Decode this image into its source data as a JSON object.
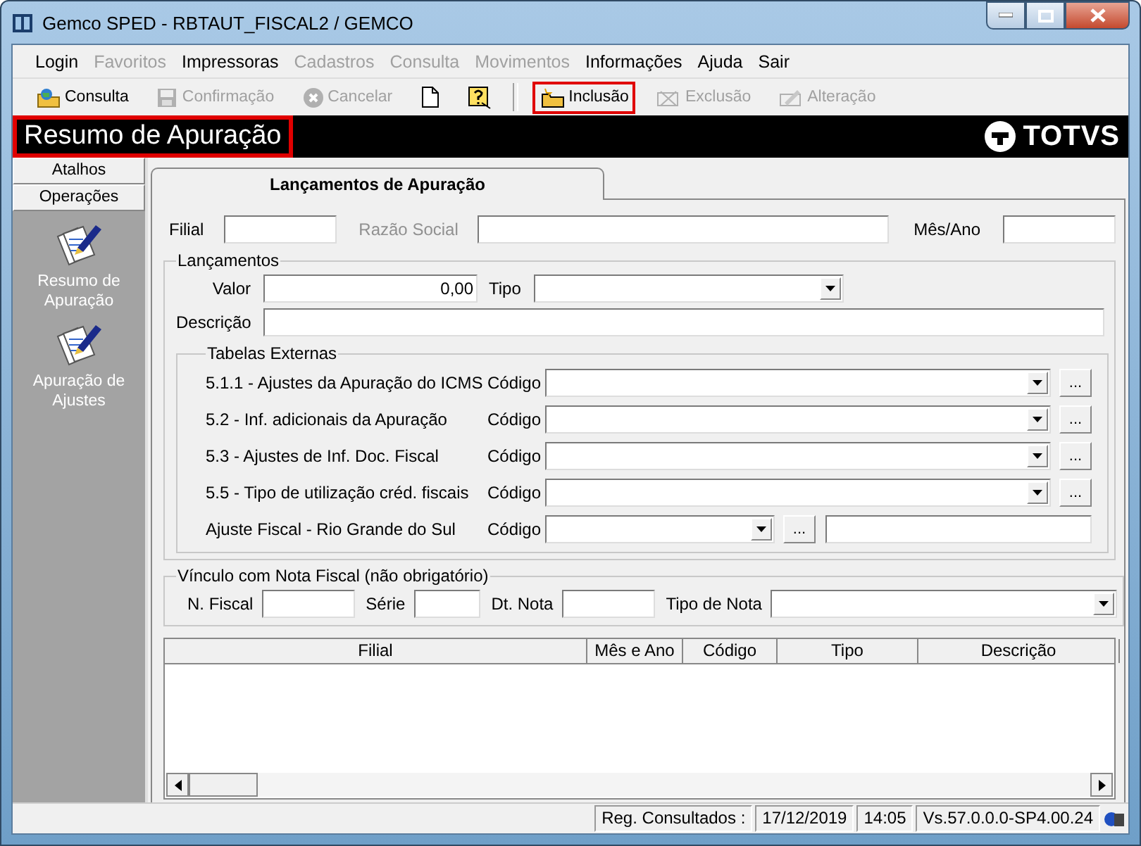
{
  "window": {
    "title": "Gemco SPED - RBTAUT_FISCAL2 / GEMCO"
  },
  "menu": [
    {
      "label": "Login",
      "disabled": false
    },
    {
      "label": "Favoritos",
      "disabled": true
    },
    {
      "label": "Impressoras",
      "disabled": false
    },
    {
      "label": "Cadastros",
      "disabled": true
    },
    {
      "label": "Consulta",
      "disabled": true
    },
    {
      "label": "Movimentos",
      "disabled": true
    },
    {
      "label": "Informações",
      "disabled": false
    },
    {
      "label": "Ajuda",
      "disabled": false
    },
    {
      "label": "Sair",
      "disabled": false
    }
  ],
  "toolbar": [
    {
      "kind": "search",
      "label": "Consulta",
      "disabled": false,
      "highlighted": false
    },
    {
      "kind": "save",
      "label": "Confirmação",
      "disabled": true,
      "highlighted": false
    },
    {
      "kind": "cancel",
      "label": "Cancelar",
      "disabled": true,
      "highlighted": false
    },
    {
      "kind": "new",
      "highlighted": false
    },
    {
      "kind": "help",
      "highlighted": false
    },
    {
      "kind": "separator"
    },
    {
      "kind": "add",
      "label": "Inclusão",
      "disabled": false,
      "highlighted": true
    },
    {
      "kind": "delete",
      "label": "Exclusão",
      "disabled": true,
      "highlighted": false
    },
    {
      "kind": "edit",
      "label": "Alteração",
      "disabled": true,
      "highlighted": false
    }
  ],
  "header": {
    "title": "Resumo de Apuração",
    "highlighted": true,
    "logo": "TOTVS"
  },
  "sidebar": {
    "sections": [
      "Atalhos",
      "Operações"
    ],
    "items": [
      {
        "label": "Resumo de Apuração"
      },
      {
        "label": "Apuração de Ajustes"
      }
    ]
  },
  "tabs": [
    {
      "label": "Lançamentos de Apuração",
      "selected": true
    }
  ],
  "header_fields": [
    {
      "label": "Filial",
      "kind": "short",
      "disabled": false
    },
    {
      "label": "Razão Social",
      "kind": "wide",
      "disabled": true
    },
    {
      "label": "Mês/Ano",
      "kind": "short",
      "disabled": false
    }
  ],
  "lancamentos": {
    "title": "Lançamentos",
    "valor": {
      "label": "Valor",
      "value": "0,00"
    },
    "tipo": {
      "label": "Tipo"
    },
    "descricao": {
      "label": "Descrição"
    },
    "tabelas": {
      "title": "Tabelas Externas",
      "rows": [
        {
          "label": "5.1.1 - Ajustes da Apuração do ICMS",
          "code_label": "Código",
          "kind": "wide",
          "button": "..."
        },
        {
          "label": "5.2 - Inf. adicionais da Apuração",
          "code_label": "Código",
          "kind": "wide",
          "button": "..."
        },
        {
          "label": "5.3 - Ajustes de Inf. Doc. Fiscal",
          "code_label": "Código",
          "kind": "wide",
          "button": "..."
        },
        {
          "label": "5.5 - Tipo de utilização créd. fiscais",
          "code_label": "Código",
          "kind": "wide",
          "button": "..."
        },
        {
          "label": "Ajuste Fiscal - Rio Grande do Sul",
          "code_label": "Código",
          "kind": "short",
          "button": "..."
        }
      ]
    }
  },
  "vinculo": {
    "title": "Vínculo com Nota Fiscal (não obrigatório)",
    "fields": [
      {
        "label": "N. Fiscal",
        "kind": "text"
      },
      {
        "label": "Série",
        "kind": "small"
      },
      {
        "label": "Dt. Nota",
        "kind": "text"
      },
      {
        "label": "Tipo de Nota",
        "kind": "combo"
      }
    ]
  },
  "table": {
    "columns": [
      "Filial",
      "Mês e Ano",
      "Código",
      "Tipo",
      "Descrição"
    ]
  },
  "status_bar": [
    "Reg. Consultados :",
    "17/12/2019",
    "14:05",
    "Vs.57.0.0.0-SP4.00.24"
  ]
}
